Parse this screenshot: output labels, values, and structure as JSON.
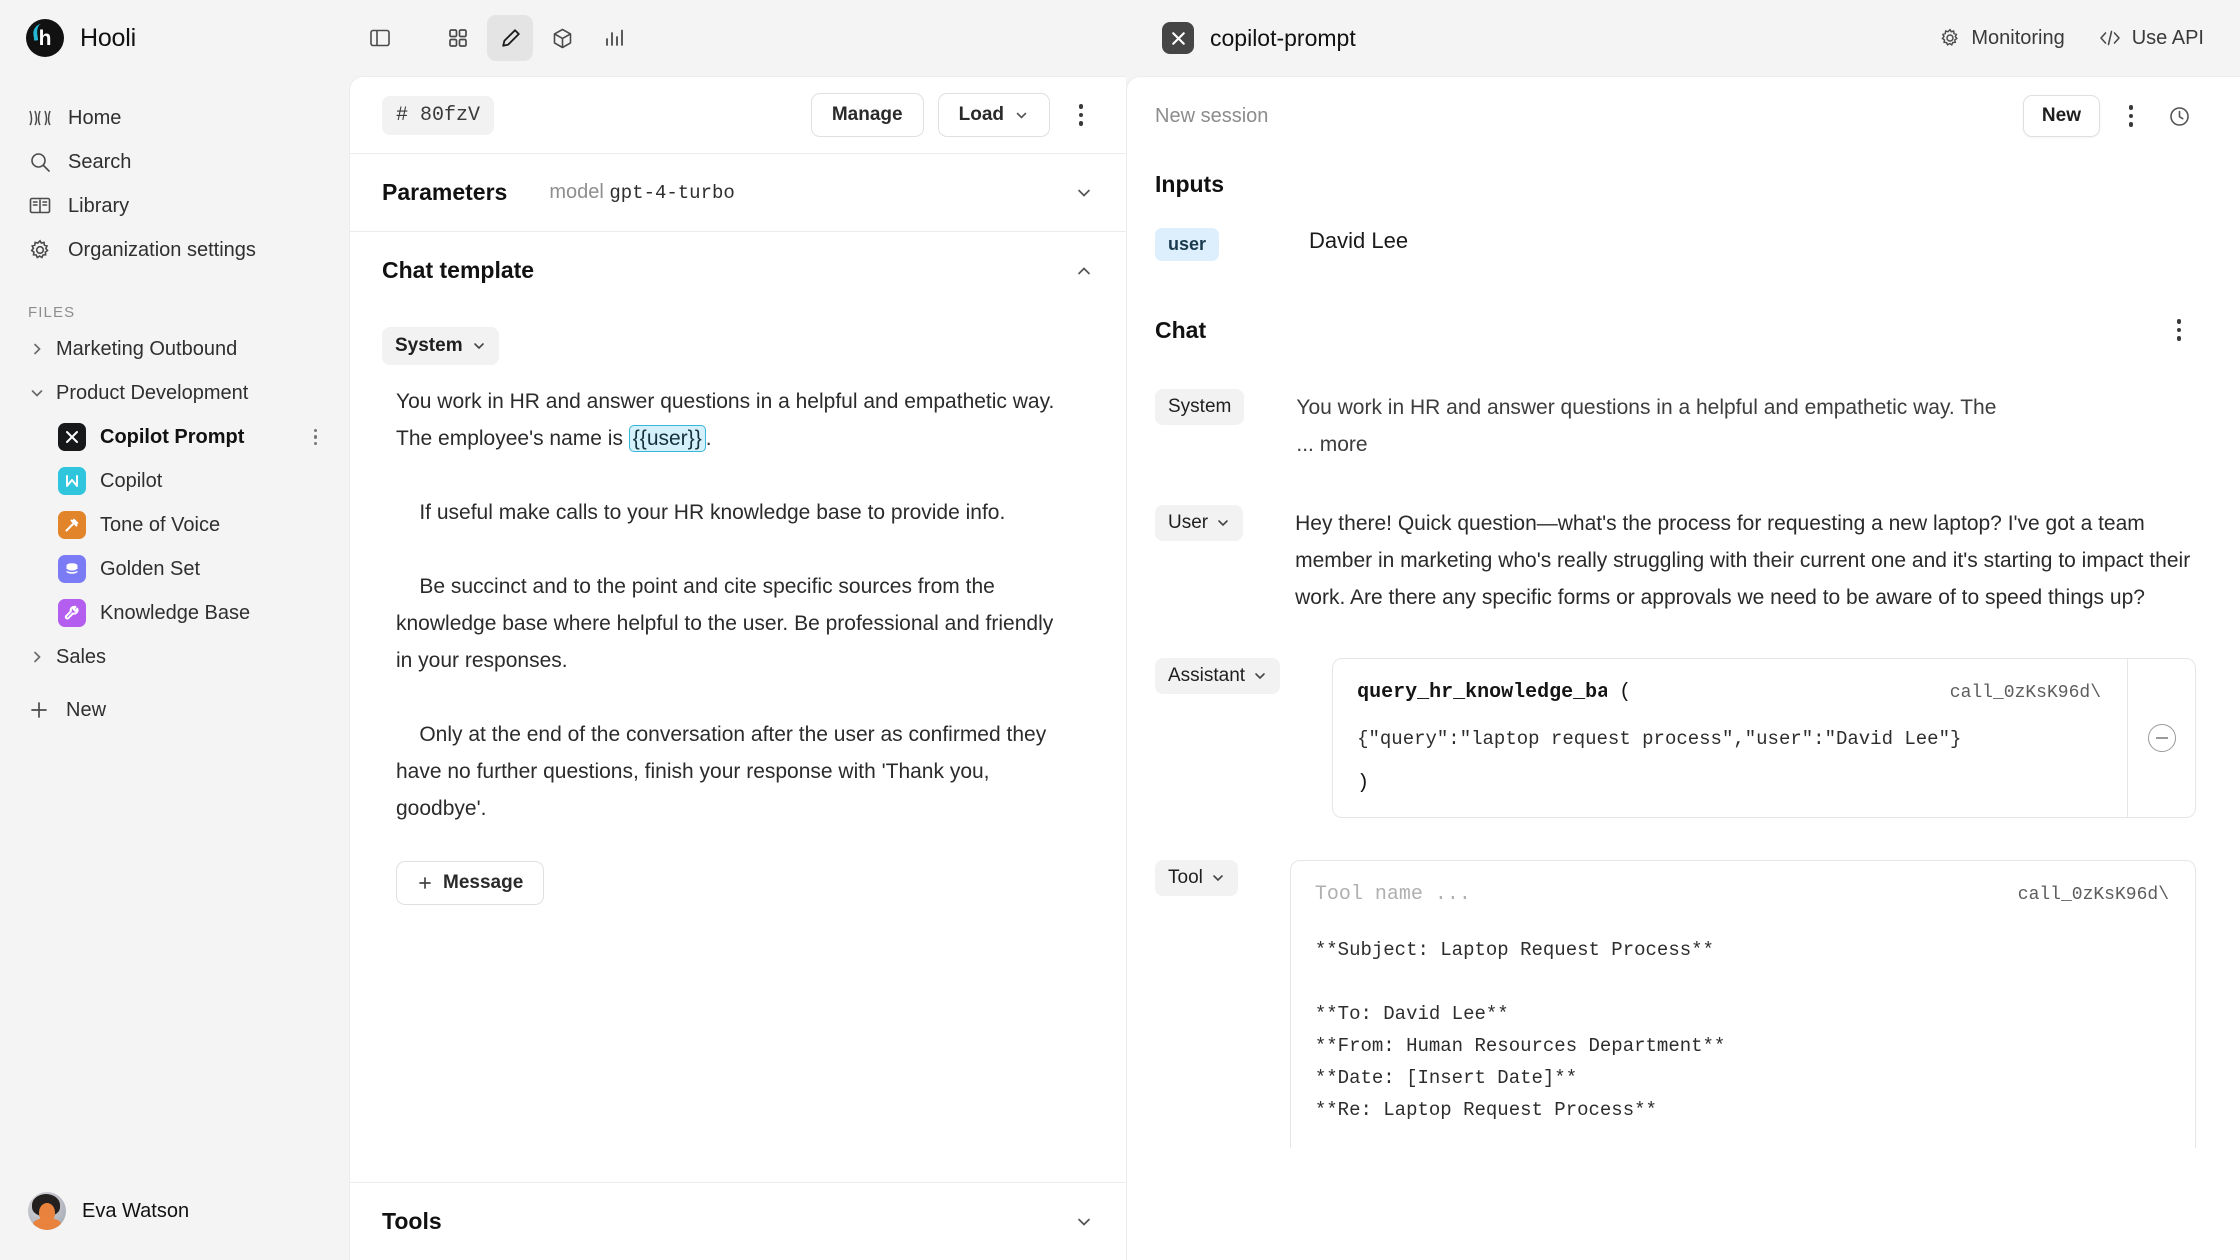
{
  "sidebar": {
    "brand": {
      "name": "Hooli",
      "logo_letter": "h"
    },
    "collapse_icon": "panel-left-icon",
    "nav": [
      {
        "label": "Home",
        "icon": "home-waves-icon"
      },
      {
        "label": "Search",
        "icon": "search-icon"
      },
      {
        "label": "Library",
        "icon": "library-book-icon"
      },
      {
        "label": "Organization settings",
        "icon": "gear-icon"
      }
    ],
    "files_label": "FILES",
    "tree": [
      {
        "label": "Marketing Outbound",
        "type": "folder",
        "expanded": false
      },
      {
        "label": "Product Development",
        "type": "folder",
        "expanded": true
      },
      {
        "label": "Copilot Prompt",
        "type": "file",
        "icon_color": "#17181a",
        "icon_glyph": "M",
        "active": true
      },
      {
        "label": "Copilot",
        "type": "file",
        "icon_color": "#2ec5dd",
        "icon_glyph": "N",
        "active": false
      },
      {
        "label": "Tone of Voice",
        "type": "file",
        "icon_color": "#e2842a",
        "icon_glyph": "gavel",
        "active": false
      },
      {
        "label": "Golden Set",
        "type": "file",
        "icon_color": "#7b7bf5",
        "icon_glyph": "db",
        "active": false
      },
      {
        "label": "Knowledge Base",
        "type": "file",
        "icon_color": "#b45ef0",
        "icon_glyph": "wrench",
        "active": false
      },
      {
        "label": "Sales",
        "type": "folder",
        "expanded": false
      }
    ],
    "new_label": "New",
    "footer_user": "Eva Watson"
  },
  "center": {
    "toolbar": {
      "panel_toggle": "panel-left-icon",
      "items": [
        {
          "name": "grid-icon",
          "selected": false
        },
        {
          "name": "pencil-icon",
          "selected": true
        },
        {
          "name": "cube-icon",
          "selected": false
        },
        {
          "name": "bar-chart-icon",
          "selected": false
        }
      ]
    },
    "version_id": "# 80fzV",
    "manage_label": "Manage",
    "load_label": "Load",
    "parameters": {
      "title": "Parameters",
      "meta_key": "model",
      "meta_value": "gpt-4-turbo"
    },
    "chat_template": {
      "title": "Chat template",
      "role": "System",
      "text_before_var": "You work in HR and answer questions in a helpful and empathetic way. The employee's name is ",
      "variable": "{{user}}",
      "text_after_var": ".\n\n    If useful make calls to your HR knowledge base to provide info.\n\n    Be succinct and to the point and cite specific sources from the knowledge base where helpful to the user. Be professional and friendly in your responses.\n\n    Only at the end of the conversation after the user as confirmed they have no further questions, finish your response with 'Thank you, goodbye'.",
      "add_message_label": "Message"
    },
    "tools": {
      "title": "Tools"
    }
  },
  "right": {
    "app_title": "copilot-prompt",
    "app_badge_glyph": "M",
    "monitoring_label": "Monitoring",
    "use_api_label": "Use API",
    "session_name": "New session",
    "new_button": "New",
    "inputs_title": "Inputs",
    "inputs": [
      {
        "key": "user",
        "value": "David Lee"
      }
    ],
    "chat_title": "Chat",
    "messages": [
      {
        "role": "System",
        "has_caret": false,
        "text": "You work in HR and answer questions in a helpful and empathetic way. The",
        "more_label": "... more"
      },
      {
        "role": "User",
        "has_caret": true,
        "text": "Hey there! Quick question—what's the process for requesting a new laptop? I've got a team member in marketing who's really struggling with their current one and it's starting to impact their work. Are there any specific forms or approvals we need to be aware of to speed things up?"
      },
      {
        "role": "Assistant",
        "has_caret": true,
        "tool_call": {
          "name": "query_hr_knowledge_ba",
          "open_paren": "(",
          "call_id": "call_0zKsK96d\\",
          "args": "{\"query\":\"laptop request process\",\"user\":\"David Lee\"}",
          "close_paren": ")"
        }
      },
      {
        "role": "Tool",
        "has_caret": true,
        "tool_result": {
          "name_placeholder": "Tool name ...",
          "call_id": "call_0zKsK96d\\",
          "output": "**Subject: Laptop Request Process**\n\n**To: David Lee**\n**From: Human Resources Department**\n**Date: [Insert Date]**\n**Re: Laptop Request Process**"
        }
      }
    ]
  },
  "colors": {
    "accent_cyan": "#2ec5dd",
    "var_highlight_bg": "#d4f1fb",
    "var_highlight_border": "#3ab6d8",
    "input_key_bg": "#ddeffc"
  }
}
